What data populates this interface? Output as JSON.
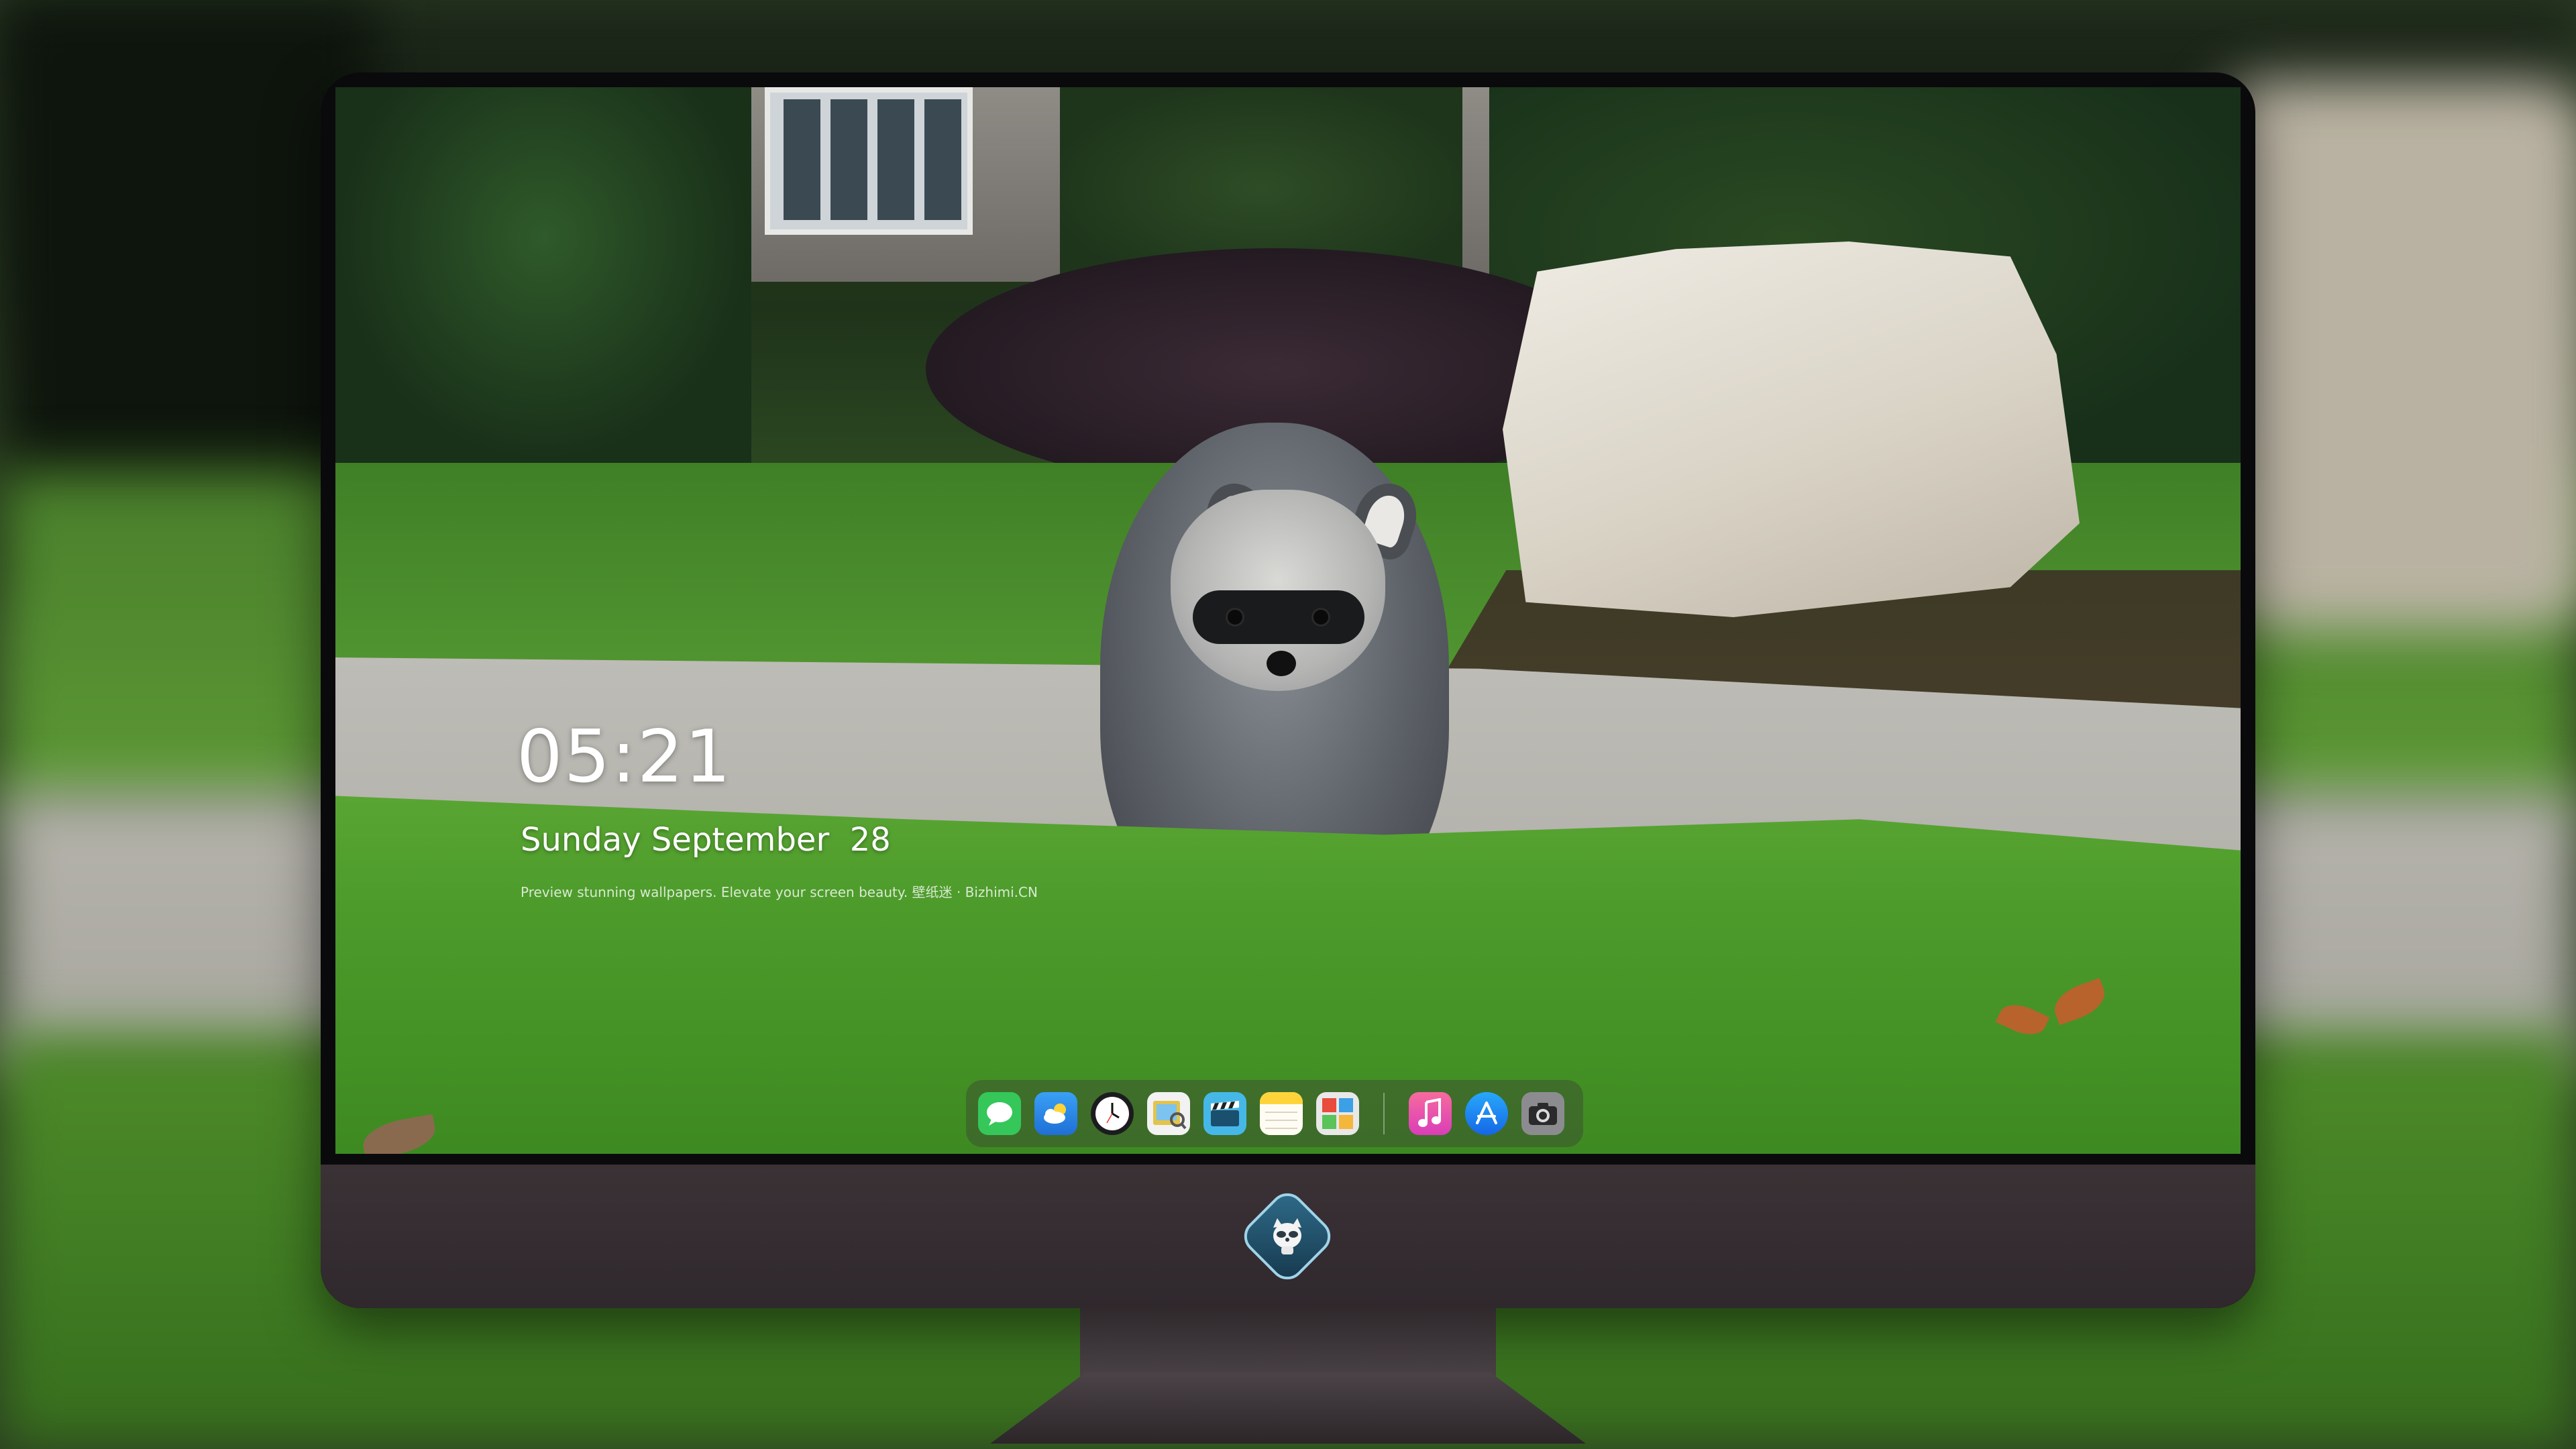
{
  "lockscreen": {
    "time": "05:21",
    "date": "Sunday September  28",
    "tagline": "Preview stunning wallpapers. Elevate your screen beauty. 壁纸迷 · Bizhimi.CN"
  },
  "dock": {
    "apps": [
      {
        "name": "Messages",
        "icon": "speech-bubble-icon",
        "color": "#35c759"
      },
      {
        "name": "Weather",
        "icon": "weather-cloud-icon",
        "color": "#2f8ff0"
      },
      {
        "name": "Clock",
        "icon": "clock-icon",
        "color": "#1c1c1e"
      },
      {
        "name": "Preview",
        "icon": "preview-icon",
        "color": "#e4c34a"
      },
      {
        "name": "Clips",
        "icon": "clapperboard-icon",
        "color": "#46b8e8"
      },
      {
        "name": "Notes",
        "icon": "notes-icon",
        "color": "#ffd43b"
      },
      {
        "name": "Photo Booth",
        "icon": "photo-grid-icon",
        "color": "#e8e8e8"
      },
      {
        "name": "Music",
        "icon": "music-note-icon",
        "color": "#f0588f"
      },
      {
        "name": "App Store",
        "icon": "app-store-icon",
        "color": "#1f8cf3"
      },
      {
        "name": "Camera",
        "icon": "camera-icon",
        "color": "#7a7a7e"
      }
    ]
  },
  "monitor": {
    "logo": "raccoon-mascot-icon"
  }
}
